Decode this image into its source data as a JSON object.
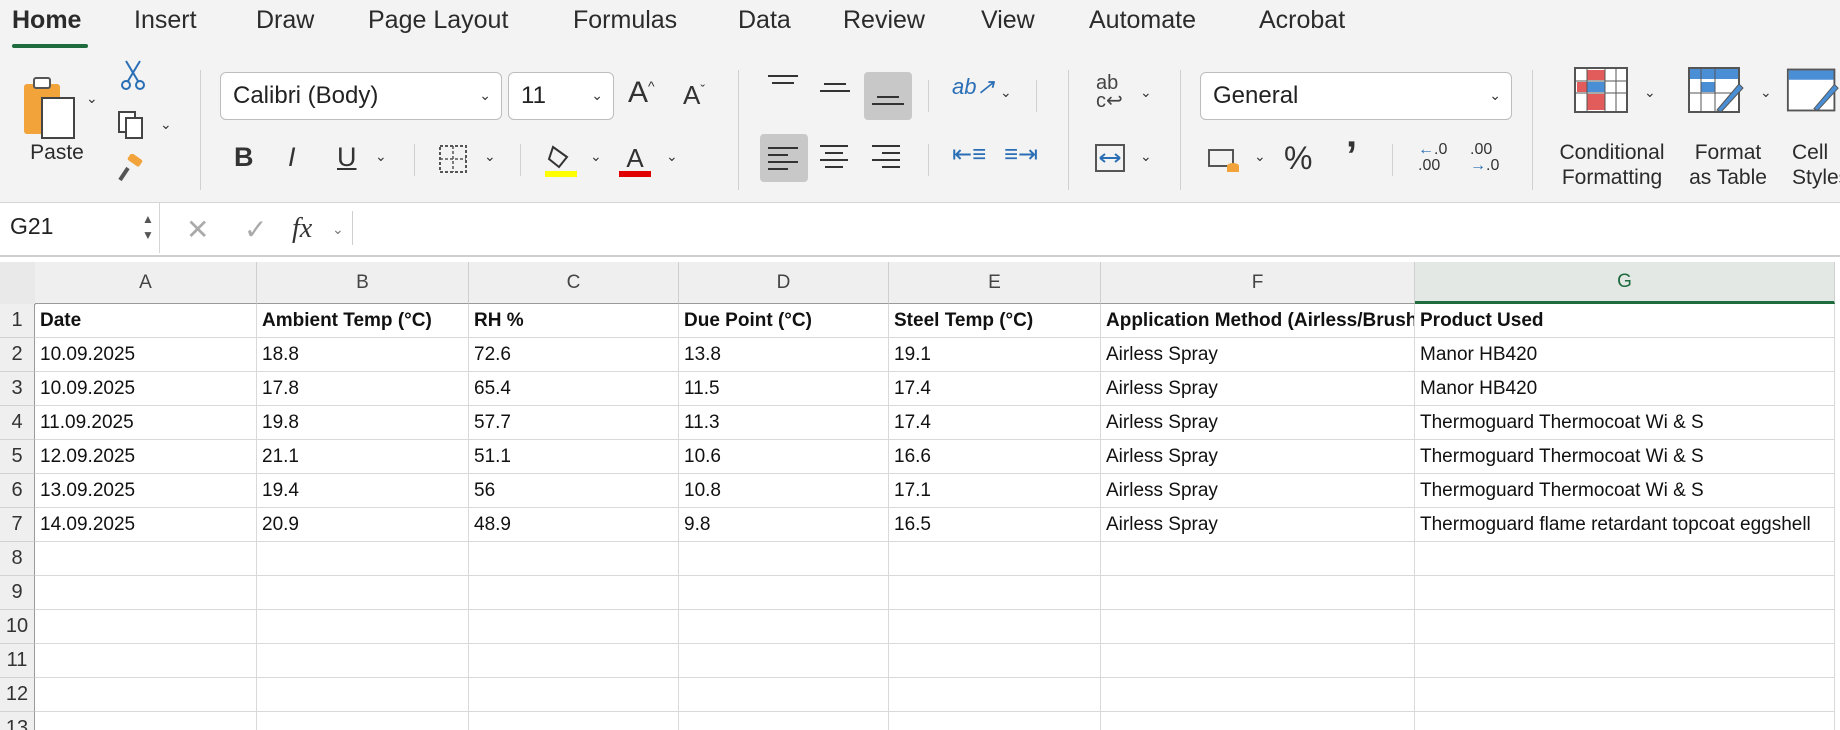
{
  "menu": {
    "tabs": [
      "Home",
      "Insert",
      "Draw",
      "Page Layout",
      "Formulas",
      "Data",
      "Review",
      "View",
      "Automate",
      "Acrobat"
    ],
    "active": "Home"
  },
  "ribbon": {
    "paste_label": "Paste",
    "font_name": "Calibri (Body)",
    "font_size": "11",
    "bold": "B",
    "italic": "I",
    "underline": "U",
    "number_format": "General",
    "percent": "%",
    "comma": "’",
    "increase_decimal": ".00",
    "decrease_decimal": ".0",
    "conditional_formatting": [
      "Conditional",
      "Formatting"
    ],
    "format_as_table": [
      "Format",
      "as Table"
    ],
    "cell_styles": [
      "Cell",
      "Styles"
    ],
    "colors": {
      "accent": "#1e6b3e",
      "highlight": "#ffff00",
      "font_color": "#e00000"
    }
  },
  "formula_bar": {
    "name_box": "G21",
    "fx": "fx",
    "formula": ""
  },
  "sheet": {
    "selected_column": "G",
    "columns": [
      "A",
      "B",
      "C",
      "D",
      "E",
      "F",
      "G"
    ],
    "row_numbers": [
      "1",
      "2",
      "3",
      "4",
      "5",
      "6",
      "7",
      "8",
      "9",
      "10",
      "11",
      "12",
      "13"
    ],
    "rows": [
      [
        "Date",
        "Ambient Temp (°C)",
        "RH %",
        "Due Point  (°C)",
        "Steel Temp (°C)",
        "Application Method (Airless/Brush/Roller)",
        "Product Used"
      ],
      [
        "10.09.2025",
        "18.8",
        "72.6",
        "13.8",
        "19.1",
        "Airless Spray",
        "Manor HB420"
      ],
      [
        "10.09.2025",
        "17.8",
        "65.4",
        "11.5",
        "17.4",
        "Airless Spray",
        "Manor HB420"
      ],
      [
        "11.09.2025",
        "19.8",
        "57.7",
        "11.3",
        "17.4",
        "Airless Spray",
        "Thermoguard Thermocoat Wi & S"
      ],
      [
        "12.09.2025",
        "21.1",
        "51.1",
        "10.6",
        "16.6",
        "Airless Spray",
        "Thermoguard Thermocoat Wi & S"
      ],
      [
        "13.09.2025",
        "19.4",
        "56",
        "10.8",
        "17.1",
        "Airless Spray",
        "Thermoguard Thermocoat Wi & S"
      ],
      [
        "14.09.2025",
        "20.9",
        "48.9",
        "9.8",
        "16.5",
        "Airless Spray",
        "Thermoguard flame retardant topcoat eggshell"
      ]
    ]
  }
}
